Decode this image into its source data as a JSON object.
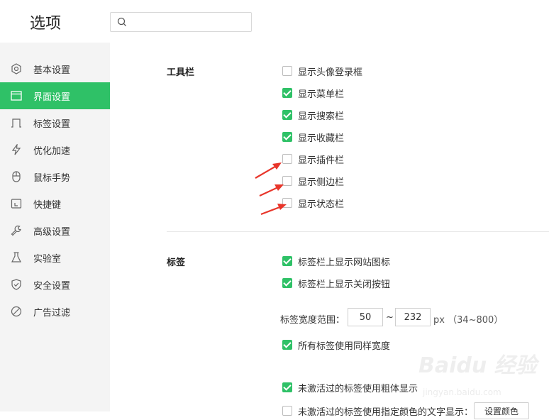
{
  "header": {
    "title": "选项",
    "search_placeholder": ""
  },
  "sidebar": {
    "items": [
      {
        "label": "基本设置",
        "icon": "gear-icon"
      },
      {
        "label": "界面设置",
        "icon": "window-icon",
        "active": true
      },
      {
        "label": "标签设置",
        "icon": "tab-icon"
      },
      {
        "label": "优化加速",
        "icon": "lightning-icon"
      },
      {
        "label": "鼠标手势",
        "icon": "mouse-icon"
      },
      {
        "label": "快捷键",
        "icon": "shortcut-icon"
      },
      {
        "label": "高级设置",
        "icon": "wrench-icon"
      },
      {
        "label": "实验室",
        "icon": "flask-icon"
      },
      {
        "label": "安全设置",
        "icon": "shield-icon"
      },
      {
        "label": "广告过滤",
        "icon": "block-icon"
      }
    ]
  },
  "toolbar_section": {
    "title": "工具栏",
    "options": [
      {
        "label": "显示头像登录框",
        "checked": false
      },
      {
        "label": "显示菜单栏",
        "checked": true
      },
      {
        "label": "显示搜索栏",
        "checked": true
      },
      {
        "label": "显示收藏栏",
        "checked": true
      },
      {
        "label": "显示插件栏",
        "checked": false
      },
      {
        "label": "显示侧边栏",
        "checked": false
      },
      {
        "label": "显示状态栏",
        "checked": false
      }
    ]
  },
  "tabs_section": {
    "title": "标签",
    "options": [
      {
        "label": "标签栏上显示网站图标",
        "checked": true
      },
      {
        "label": "标签栏上显示关闭按钮",
        "checked": true
      }
    ],
    "width_range": {
      "label": "标签宽度范围：",
      "min": "50",
      "separator": "~",
      "max": "232",
      "unit": "px （34~800）"
    },
    "same_width": {
      "label": "所有标签使用同样宽度",
      "checked": true
    },
    "bold_inactive": {
      "label": "未激活过的标签使用粗体显示",
      "checked": true
    },
    "color_inactive": {
      "label": "未激活过的标签使用指定颜色的文字显示：",
      "checked": false
    },
    "color_button": "设置颜色"
  },
  "watermark": {
    "logo": "Baidu 经验",
    "url": "jingyan.baidu.com"
  },
  "colors": {
    "accent": "#2fc167",
    "sidebar_bg": "#f4f4f4",
    "annotation_arrow": "#e8352a"
  }
}
